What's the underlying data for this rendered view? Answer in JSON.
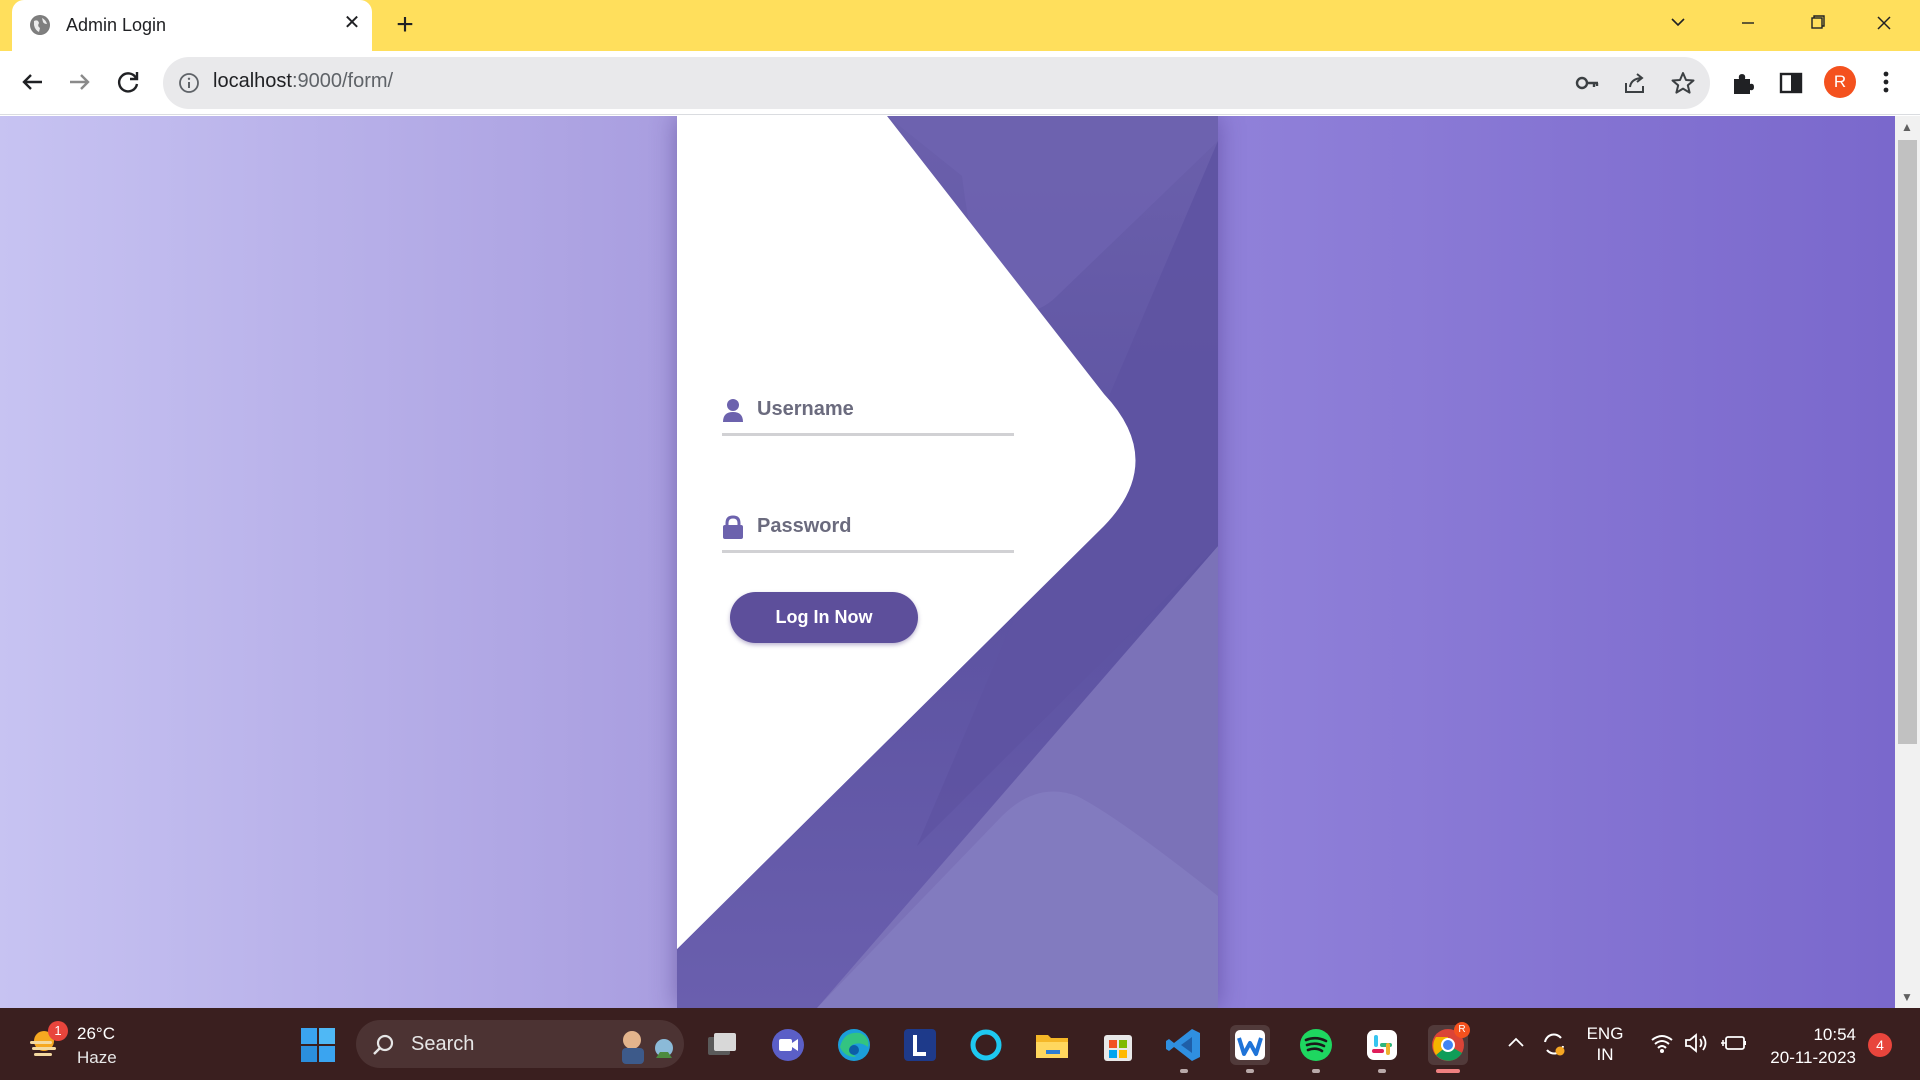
{
  "browser": {
    "tab_title": "Admin Login",
    "tab_close": "✕",
    "new_tab": "+",
    "url_host": "localhost",
    "url_path": ":9000/form/",
    "profile_initial": "R",
    "theme_color": "#ffdf5c"
  },
  "page": {
    "username_placeholder": "Username",
    "password_placeholder": "Password",
    "login_label": "Log In Now",
    "accent_color": "#5d4f9b"
  },
  "taskbar": {
    "weather_temp": "26°C",
    "weather_condition": "Haze",
    "weather_badge": "1",
    "search_label": "Search",
    "language_top": "ENG",
    "language_bottom": "IN",
    "time": "10:54",
    "date": "20-11-2023",
    "notification_count": "4",
    "chrome_badge": "R",
    "apps": [
      "task-view",
      "teams-chat",
      "edge",
      "lexicon",
      "cortana",
      "file-explorer",
      "microsoft-store",
      "vscode",
      "word-app",
      "spotify",
      "slack",
      "chrome"
    ]
  }
}
